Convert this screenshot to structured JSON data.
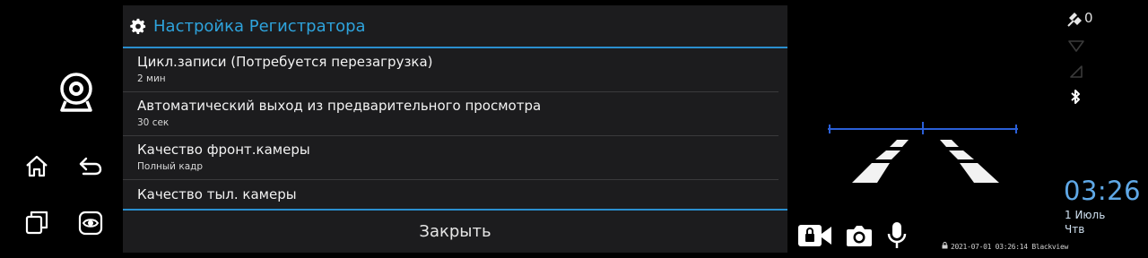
{
  "dialog": {
    "title": "Настройка Регистратора",
    "items": [
      {
        "title": "Цикл.записи (Потребуется перезагрузка)",
        "value": "2 мин"
      },
      {
        "title": "Автоматический выход из предварительного просмотра",
        "value": "30 сек"
      },
      {
        "title": "Качество фронт.камеры",
        "value": "Полный кадр"
      },
      {
        "title": "Качество тыл. камеры"
      }
    ],
    "close_label": "Закрыть"
  },
  "status": {
    "satellites": "0",
    "time": "03:26",
    "date": "1 Июль",
    "weekday": "Чтв"
  },
  "recording_stamp": "2021-07-01 03:26:14 Blackview",
  "colors": {
    "accent": "#2ea3dc",
    "dialog_bg": "#1c1c1e",
    "clock": "#5fa8e6",
    "lane_line": "#2a5fd8"
  },
  "icons": {
    "dashcam": "webcam-icon",
    "home": "home-icon",
    "back": "back-arrow-icon",
    "recents": "recent-apps-icon",
    "preview": "eye-icon",
    "settings": "gear-icon",
    "lock_record": "lock-video-icon",
    "photo": "camera-icon",
    "mic": "microphone-icon",
    "gps": "satellite-icon",
    "wifi": "wifi-icon",
    "signal": "cell-signal-icon",
    "bluetooth": "bluetooth-icon"
  }
}
